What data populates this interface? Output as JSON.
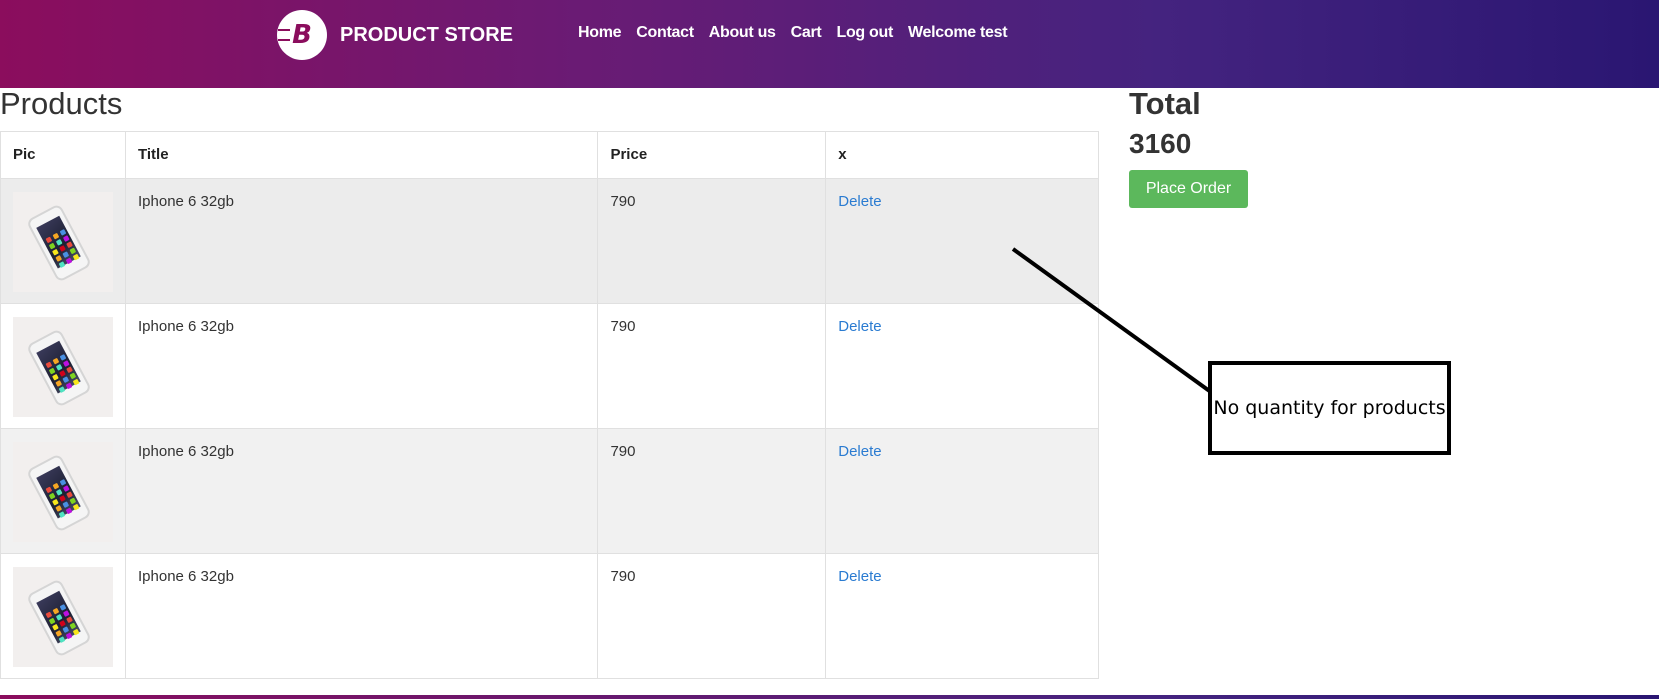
{
  "brand": {
    "name": "PRODUCT STORE",
    "logo_letter": "B"
  },
  "nav": {
    "items": [
      "Home",
      "Contact",
      "About us",
      "Cart",
      "Log out",
      "Welcome test"
    ]
  },
  "products": {
    "title": "Products",
    "columns": [
      "Pic",
      "Title",
      "Price",
      "x"
    ],
    "rows": [
      {
        "title": "Iphone 6 32gb",
        "price": "790",
        "action": "Delete"
      },
      {
        "title": "Iphone 6 32gb",
        "price": "790",
        "action": "Delete"
      },
      {
        "title": "Iphone 6 32gb",
        "price": "790",
        "action": "Delete"
      },
      {
        "title": "Iphone 6 32gb",
        "price": "790",
        "action": "Delete"
      }
    ]
  },
  "total": {
    "label": "Total",
    "value": "3160",
    "button": "Place Order"
  },
  "annotation": {
    "text": "No quantity for products"
  },
  "colors": {
    "nav_gradient_start": "#8b0d5d",
    "nav_gradient_end": "#2a1672",
    "button_green": "#5cb85c",
    "link_blue": "#2a7bd1"
  }
}
